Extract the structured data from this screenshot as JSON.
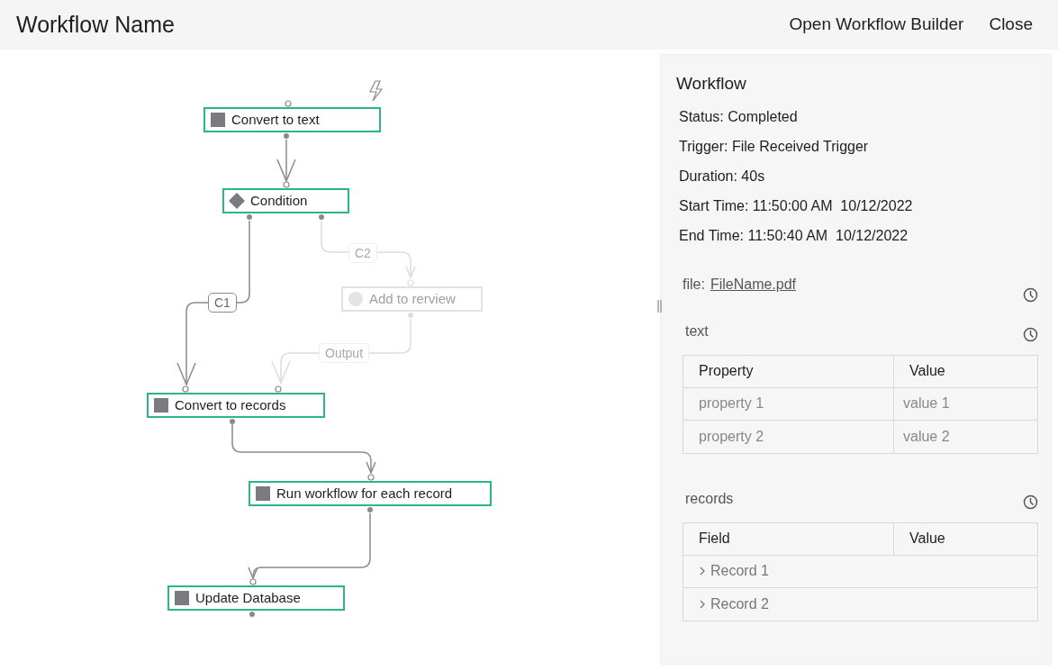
{
  "header": {
    "title": "Workflow Name",
    "actions": [
      "Open Workflow Builder",
      "Close"
    ]
  },
  "diagram": {
    "nodes": [
      {
        "label": "Convert to text",
        "kind": "square",
        "disabled": false
      },
      {
        "label": "Condition",
        "kind": "diamond",
        "disabled": false
      },
      {
        "label": "Add to rerview",
        "kind": "circle",
        "disabled": true
      },
      {
        "label": "Convert to records",
        "kind": "square",
        "disabled": false
      },
      {
        "label": "Run workflow for each record",
        "kind": "square",
        "disabled": false
      },
      {
        "label": "Update Database",
        "kind": "square",
        "disabled": false
      }
    ],
    "edge_labels": [
      {
        "label": "C1",
        "disabled": false
      },
      {
        "label": "C2",
        "disabled": true
      },
      {
        "label": "Output",
        "disabled": true
      }
    ]
  },
  "panel": {
    "title": "Workflow",
    "details": [
      "Status: Completed",
      "Trigger: File Received Trigger",
      "Duration: 40s",
      "Start Time: 11:50:00 AM  10/12/2022",
      "End Time: 11:50:40 AM  10/12/2022"
    ],
    "file": {
      "label": "file:",
      "link": "FileName.pdf"
    },
    "text_section": {
      "title": "text",
      "columns": [
        "Property",
        "Value"
      ],
      "rows": [
        {
          "cells": [
            "property 1",
            "value 1"
          ]
        },
        {
          "cells": [
            "property 2",
            "value 2"
          ]
        }
      ]
    },
    "records_section": {
      "title": "records",
      "columns": [
        "Field",
        "Value"
      ],
      "rows": [
        {
          "label": "Record 1",
          "expanded": false
        },
        {
          "label": "Record 2",
          "expanded": false
        }
      ]
    }
  }
}
